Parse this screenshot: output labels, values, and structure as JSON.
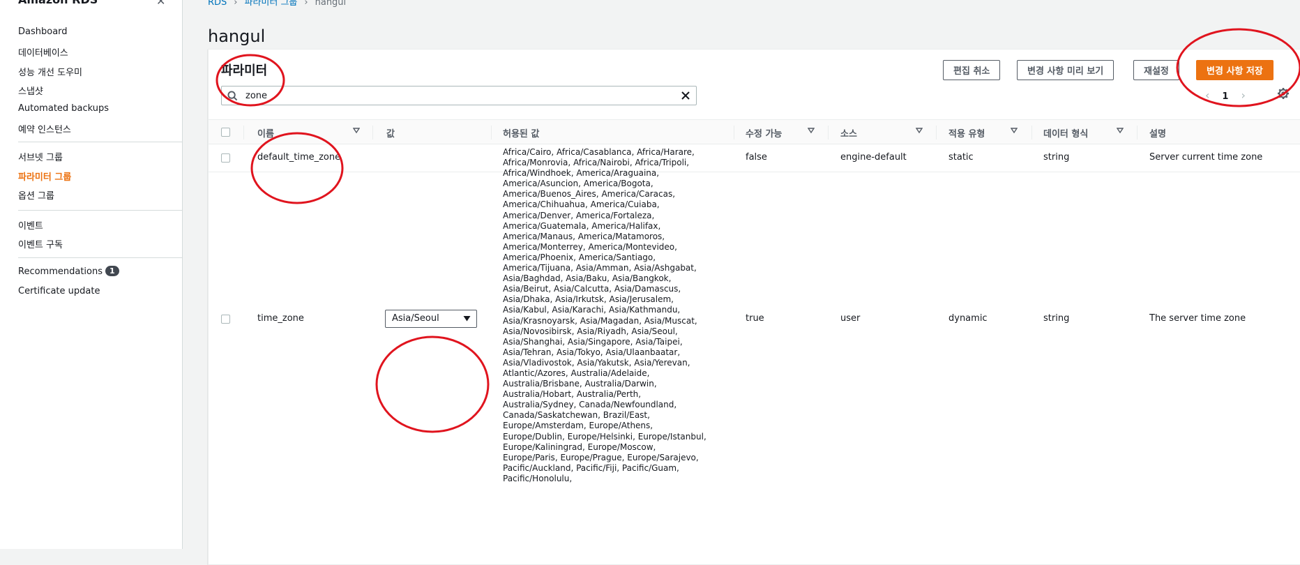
{
  "sidebar": {
    "header": "Amazon RDS",
    "items": [
      {
        "label": "Dashboard"
      },
      {
        "label": "데이터베이스"
      },
      {
        "label": "성능 개선 도우미"
      },
      {
        "label": "스냅샷"
      },
      {
        "label": "Automated backups"
      },
      {
        "label": "예약 인스턴스"
      },
      {
        "label": "서브넷 그룹"
      },
      {
        "label": "파라미터 그룹",
        "active": true
      },
      {
        "label": "옵션 그룹"
      },
      {
        "label": "이벤트"
      },
      {
        "label": "이벤트 구독"
      },
      {
        "label": "Recommendations",
        "badge": "1"
      },
      {
        "label": "Certificate update"
      }
    ]
  },
  "breadcrumb": [
    "RDS",
    "파라미터 그룹",
    "hangul"
  ],
  "page": {
    "title": "hangul"
  },
  "panel": {
    "title": "파라미터",
    "search_value": "zone",
    "buttons": {
      "cancel": "편집 취소",
      "preview": "변경 사항 미리 보기",
      "reset": "재설정",
      "save": "변경 사항 저장"
    },
    "pagination": {
      "current_page": "1",
      "prev": "‹",
      "next": "›"
    }
  },
  "table": {
    "columns": [
      "이름",
      "값",
      "허용된 값",
      "수정 가능",
      "소스",
      "적용 유형",
      "데이터 형식",
      "설명"
    ],
    "rows": [
      {
        "name": "default_time_zone",
        "value": "",
        "allowed": "",
        "modifiable": "false",
        "source": "engine-default",
        "apply_type": "static",
        "data_type": "string",
        "description": "Server current time zone"
      },
      {
        "name": "time_zone",
        "value": "Asia/Seoul",
        "allowed": "Africa/Cairo, Africa/Casablanca, Africa/Harare, Africa/Monrovia, Africa/Nairobi, Africa/Tripoli, Africa/Windhoek, America/Araguaina, America/Asuncion, America/Bogota, America/Buenos_Aires, America/Caracas, America/Chihuahua, America/Cuiaba, America/Denver, America/Fortaleza, America/Guatemala, America/Halifax, America/Manaus, America/Matamoros, America/Monterrey, America/Montevideo, America/Phoenix, America/Santiago, America/Tijuana, Asia/Amman, Asia/Ashgabat, Asia/Baghdad, Asia/Baku, Asia/Bangkok, Asia/Beirut, Asia/Calcutta, Asia/Damascus, Asia/Dhaka, Asia/Irkutsk, Asia/Jerusalem, Asia/Kabul, Asia/Karachi, Asia/Kathmandu, Asia/Krasnoyarsk, Asia/Magadan, Asia/Muscat, Asia/Novosibirsk, Asia/Riyadh, Asia/Seoul, Asia/Shanghai, Asia/Singapore, Asia/Taipei, Asia/Tehran, Asia/Tokyo, Asia/Ulaanbaatar, Asia/Vladivostok, Asia/Yakutsk, Asia/Yerevan, Atlantic/Azores, Australia/Adelaide, Australia/Brisbane, Australia/Darwin, Australia/Hobart, Australia/Perth, Australia/Sydney, Canada/Newfoundland, Canada/Saskatchewan, Brazil/East, Europe/Amsterdam, Europe/Athens, Europe/Dublin, Europe/Helsinki, Europe/Istanbul, Europe/Kaliningrad, Europe/Moscow, Europe/Paris, Europe/Prague, Europe/Sarajevo, Pacific/Auckland, Pacific/Fiji, Pacific/Guam, Pacific/Honolulu,",
        "modifiable": "true",
        "source": "user",
        "apply_type": "dynamic",
        "data_type": "string",
        "description": "The server time zone"
      }
    ]
  },
  "icons": {
    "search": "search-icon",
    "clear": "close-icon",
    "sort": "sort-caret-icon",
    "dropdown": "caret-down-icon",
    "settings": "gear-icon"
  },
  "colors": {
    "accent": "#ec7211",
    "link": "#0073bb",
    "annotation": "#e0141e"
  }
}
